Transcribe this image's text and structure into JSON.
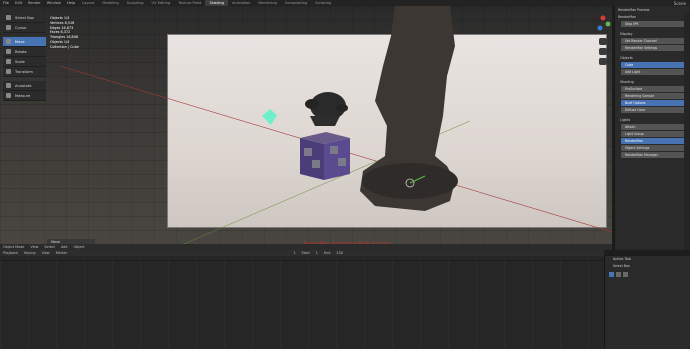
{
  "topbar": {
    "menus": [
      "File",
      "Edit",
      "Render",
      "Window",
      "Help"
    ],
    "workspaces": [
      "Layout",
      "Modeling",
      "Sculpting",
      "UV Editing",
      "Texture Paint",
      "Shading",
      "Animation",
      "Rendering",
      "Compositing",
      "Scripting"
    ],
    "active_workspace": "Shading",
    "scene": "Scene"
  },
  "tools": [
    {
      "label": "Select Box",
      "active": false
    },
    {
      "label": "Cursor",
      "active": false
    },
    {
      "label": "Move",
      "active": true
    },
    {
      "label": "Rotate",
      "active": false
    },
    {
      "label": "Scale",
      "active": false
    },
    {
      "label": "Transform",
      "active": false
    },
    {
      "label": "Annotate",
      "active": false
    },
    {
      "label": "Measure",
      "active": false
    }
  ],
  "stats": [
    "Objects 1/4",
    "Vertices 8,516",
    "Edges 16,873",
    "Faces 8,372",
    "Triangles 16,806",
    "Objects 1/4",
    "Collection | Cube"
  ],
  "npanel": {
    "rows": [
      "RenderMan Preview",
      "RenderMan"
    ],
    "fields1": [
      "Stop IPR"
    ],
    "section_display": "Display",
    "fields2": [
      "Set Render Channel",
      "RenderMan Settings"
    ],
    "section_objects": "Objects",
    "fields3": [
      "Cube",
      "Add Light"
    ],
    "section_shading": "Shading",
    "fields4": [
      "PxrSurface",
      "Rendering Sample",
      "Bxdf Options",
      "Diffuse Color"
    ],
    "section_lights": "Lights",
    "fields5": [
      "Attach",
      "Light Group"
    ],
    "fields6": [
      "RenderMan",
      "Object Settings"
    ],
    "field_bottom": "RenderMan Manager"
  },
  "viewport_bottom": [
    "Object Mode",
    "View",
    "Select",
    "Add",
    "Object"
  ],
  "move_panel": "Move",
  "status_message": "RenderMan Interactive Mode Running",
  "timeline": {
    "items": [
      "Playback",
      "Keying",
      "View",
      "Marker"
    ],
    "frame": "1",
    "start": "Start",
    "start_val": "1",
    "end": "End",
    "end_val": "250"
  },
  "toolpanel": {
    "title": "Active Tool",
    "item": "Select Box"
  }
}
